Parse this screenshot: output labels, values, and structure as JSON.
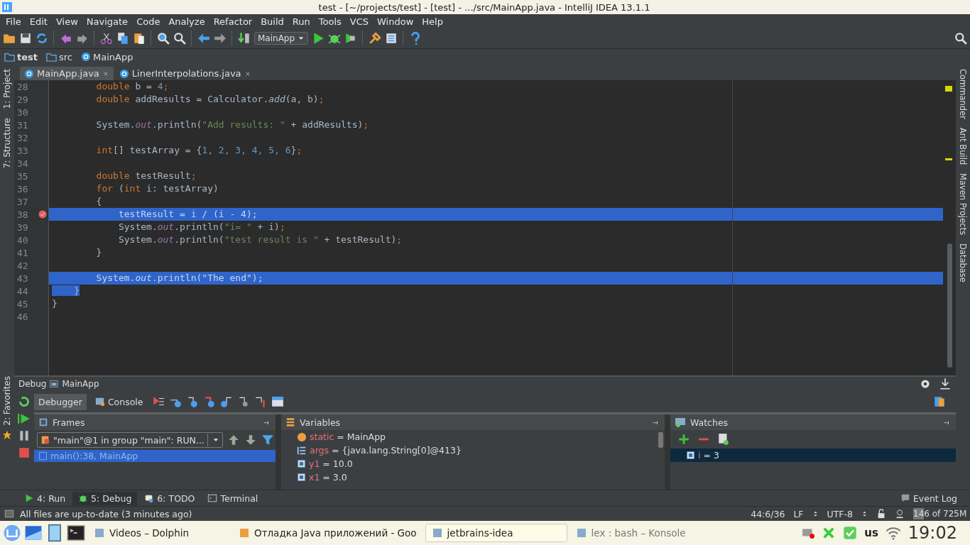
{
  "window": {
    "title": "test - [~/projects/test] - [test] - .../src/MainApp.java - IntelliJ IDEA 13.1.1"
  },
  "menu": [
    "File",
    "Edit",
    "View",
    "Navigate",
    "Code",
    "Analyze",
    "Refactor",
    "Build",
    "Run",
    "Tools",
    "VCS",
    "Window",
    "Help"
  ],
  "toolbar": {
    "run_config": "MainApp"
  },
  "breadcrumbs": [
    "test",
    "src",
    "MainApp"
  ],
  "editor_tabs": [
    {
      "label": "MainApp.java",
      "selected": true
    },
    {
      "label": "LinerInterpolations.java",
      "selected": false
    }
  ],
  "left_tool_strip": [
    "1: Project",
    "7: Structure"
  ],
  "left_tool_strip_bottom": [
    "2: Favorites"
  ],
  "right_tool_strip": [
    "Commander",
    "Ant Build",
    "Maven Projects",
    "Database"
  ],
  "editor": {
    "lines": [
      {
        "number": "28",
        "tokens": [
          {
            "kind": "keyword",
            "text": "        double"
          },
          {
            "kind": "plain",
            "text": " b = "
          },
          {
            "kind": "number",
            "text": "4"
          },
          {
            "kind": "punct",
            "text": ";"
          }
        ]
      },
      {
        "number": "29",
        "tokens": [
          {
            "kind": "keyword",
            "text": "        double"
          },
          {
            "kind": "plain",
            "text": " addResults = Calculator."
          },
          {
            "kind": "method",
            "text": "add"
          },
          {
            "kind": "plain",
            "text": "(a, b)"
          },
          {
            "kind": "punct",
            "text": ";"
          }
        ]
      },
      {
        "number": "30"
      },
      {
        "number": "31",
        "tokens": [
          {
            "kind": "plain",
            "text": "        System."
          },
          {
            "kind": "field",
            "text": "out"
          },
          {
            "kind": "plain",
            "text": ".println("
          },
          {
            "kind": "string",
            "text": "\"Add results: \""
          },
          {
            "kind": "plain",
            "text": " + addResults)"
          },
          {
            "kind": "punct",
            "text": ";"
          }
        ]
      },
      {
        "number": "32"
      },
      {
        "number": "33",
        "tokens": [
          {
            "kind": "keyword",
            "text": "        int"
          },
          {
            "kind": "plain",
            "text": "[] testArray = {"
          },
          {
            "kind": "number",
            "text": "1, 2, 3, 4, 5, 6"
          },
          {
            "kind": "plain",
            "text": "}"
          },
          {
            "kind": "punct",
            "text": ";"
          }
        ]
      },
      {
        "number": "34"
      },
      {
        "number": "35",
        "tokens": [
          {
            "kind": "keyword",
            "text": "        double"
          },
          {
            "kind": "plain",
            "text": " testResult"
          },
          {
            "kind": "punct",
            "text": ";"
          }
        ]
      },
      {
        "number": "36",
        "tokens": [
          {
            "kind": "keyword",
            "text": "        for"
          },
          {
            "kind": "plain",
            "text": " ("
          },
          {
            "kind": "keyword",
            "text": "int"
          },
          {
            "kind": "plain",
            "text": " i: testArray)"
          }
        ]
      },
      {
        "number": "37",
        "tokens": [
          {
            "kind": "plain",
            "text": "        {"
          }
        ]
      },
      {
        "number": "38",
        "breakpoint": true,
        "execution_point": true,
        "tokens": [
          {
            "kind": "plain",
            "text": "            testResult = i / (i - "
          },
          {
            "kind": "number",
            "text": "4"
          },
          {
            "kind": "plain",
            "text": ")"
          },
          {
            "kind": "punct",
            "text": ";"
          }
        ]
      },
      {
        "number": "39",
        "tokens": [
          {
            "kind": "plain",
            "text": "            System."
          },
          {
            "kind": "field",
            "text": "out"
          },
          {
            "kind": "plain",
            "text": ".println("
          },
          {
            "kind": "string",
            "text": "\"i= \""
          },
          {
            "kind": "plain",
            "text": " + i)"
          },
          {
            "kind": "punct",
            "text": ";"
          }
        ]
      },
      {
        "number": "40",
        "tokens": [
          {
            "kind": "plain",
            "text": "            System."
          },
          {
            "kind": "field",
            "text": "out"
          },
          {
            "kind": "plain",
            "text": ".println("
          },
          {
            "kind": "string",
            "text": "\"test result is \""
          },
          {
            "kind": "plain",
            "text": " + testResult)"
          },
          {
            "kind": "punct",
            "text": ";"
          }
        ]
      },
      {
        "number": "41",
        "tokens": [
          {
            "kind": "plain",
            "text": "        }"
          }
        ]
      },
      {
        "number": "42"
      },
      {
        "number": "43",
        "selected": true,
        "tokens": [
          {
            "kind": "plain",
            "text": "        System."
          },
          {
            "kind": "field",
            "text": "out"
          },
          {
            "kind": "plain",
            "text": ".println("
          },
          {
            "kind": "string",
            "text": "\"The end\""
          },
          {
            "kind": "plain",
            "text": ")"
          },
          {
            "kind": "punct",
            "text": ";"
          }
        ]
      },
      {
        "number": "44",
        "selected": true,
        "tokens": [
          {
            "kind": "plain",
            "text": "    }"
          }
        ]
      },
      {
        "number": "45",
        "tokens": [
          {
            "kind": "plain",
            "text": "}"
          }
        ]
      },
      {
        "number": "46"
      }
    ]
  },
  "debug": {
    "title": "Debug",
    "config": "MainApp",
    "tabs": [
      {
        "label": "Debugger",
        "selected": true
      },
      {
        "label": "Console",
        "selected": false
      }
    ],
    "frames": {
      "title": "Frames",
      "thread": "\"main\"@1 in group \"main\": RUN...",
      "items": [
        {
          "label": "main():38, MainApp",
          "selected": true
        }
      ]
    },
    "variables": {
      "title": "Variables",
      "items": [
        {
          "kind": "static",
          "name": "static",
          "value": "= MainApp"
        },
        {
          "kind": "array",
          "name": "args",
          "value": "= {java.lang.String[0]@413}"
        },
        {
          "kind": "primitive",
          "name": "y1",
          "value": "= 10.0"
        },
        {
          "kind": "primitive",
          "name": "x1",
          "value": "= 3.0"
        }
      ]
    },
    "watches": {
      "title": "Watches",
      "items": [
        {
          "kind": "primitive",
          "name": "i",
          "value": "= 3",
          "selected": true
        }
      ]
    }
  },
  "tool_tabs": [
    {
      "kind": "run",
      "label": "4: Run",
      "selected": false
    },
    {
      "kind": "debug",
      "label": "5: Debug",
      "selected": true
    },
    {
      "kind": "todo",
      "label": "6: TODO",
      "selected": false
    },
    {
      "kind": "terminal",
      "label": "Terminal",
      "selected": false
    }
  ],
  "event_log": "Event Log",
  "status_bar": {
    "message": "All files are up-to-date (3 minutes ago)",
    "position": "44:6/36",
    "line_separator": "LF",
    "encoding": "UTF-8",
    "memory": {
      "label": "146 of 725M",
      "level": 0.2
    }
  },
  "taskbar": {
    "tasks": [
      {
        "label": "Videos – Dolphin",
        "selected": false
      },
      {
        "label": "Отладка Java приложений - Goo",
        "selected": false
      },
      {
        "label": "jetbrains-idea",
        "selected": true
      },
      {
        "label": "lex : bash – Konsole",
        "selected": false
      }
    ],
    "keyboard": "us",
    "clock": "19:02"
  }
}
